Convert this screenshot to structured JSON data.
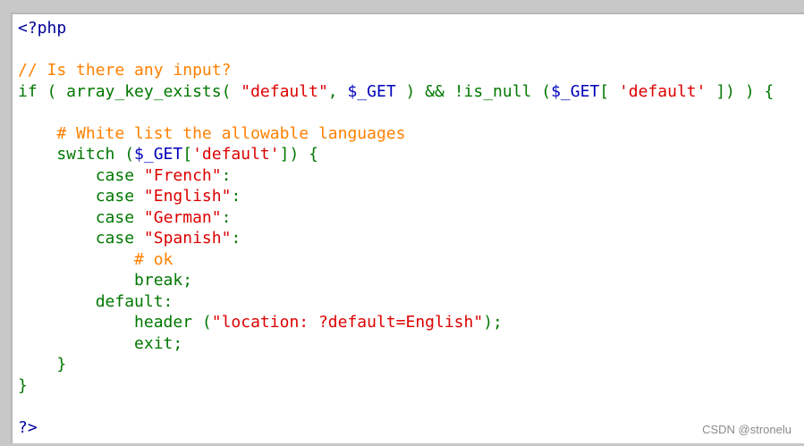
{
  "colors": {
    "code_background": "#ffffff",
    "page_background": "#c8c8c8",
    "php_tag": "#000099",
    "keyword": "#007700",
    "variable": "#0000BB",
    "string": "#DD0000",
    "comment": "#FF8000",
    "plain": "#007700",
    "watermark": "#8a8a8a"
  },
  "code": {
    "lines": [
      [
        {
          "t": "<?php",
          "c": "php_tag"
        }
      ],
      [],
      [
        {
          "t": "// Is there any input?",
          "c": "comment"
        }
      ],
      [
        {
          "t": "if ( array_key_exists( ",
          "c": "keyword"
        },
        {
          "t": "\"default\"",
          "c": "string"
        },
        {
          "t": ", ",
          "c": "keyword"
        },
        {
          "t": "$_GET",
          "c": "variable"
        },
        {
          "t": " ) && !is_null (",
          "c": "keyword"
        },
        {
          "t": "$_GET",
          "c": "variable"
        },
        {
          "t": "[ ",
          "c": "keyword"
        },
        {
          "t": "'default'",
          "c": "string"
        },
        {
          "t": " ]) ) {",
          "c": "keyword"
        }
      ],
      [],
      [
        {
          "t": "    # White list the allowable languages",
          "c": "comment"
        }
      ],
      [
        {
          "t": "    switch (",
          "c": "keyword"
        },
        {
          "t": "$_GET",
          "c": "variable"
        },
        {
          "t": "[",
          "c": "keyword"
        },
        {
          "t": "'default'",
          "c": "string"
        },
        {
          "t": "]) {",
          "c": "keyword"
        }
      ],
      [
        {
          "t": "        case ",
          "c": "keyword"
        },
        {
          "t": "\"French\"",
          "c": "string"
        },
        {
          "t": ":",
          "c": "keyword"
        }
      ],
      [
        {
          "t": "        case ",
          "c": "keyword"
        },
        {
          "t": "\"English\"",
          "c": "string"
        },
        {
          "t": ":",
          "c": "keyword"
        }
      ],
      [
        {
          "t": "        case ",
          "c": "keyword"
        },
        {
          "t": "\"German\"",
          "c": "string"
        },
        {
          "t": ":",
          "c": "keyword"
        }
      ],
      [
        {
          "t": "        case ",
          "c": "keyword"
        },
        {
          "t": "\"Spanish\"",
          "c": "string"
        },
        {
          "t": ":",
          "c": "keyword"
        }
      ],
      [
        {
          "t": "            # ok",
          "c": "comment"
        }
      ],
      [
        {
          "t": "            break;",
          "c": "keyword"
        }
      ],
      [
        {
          "t": "        default:",
          "c": "keyword"
        }
      ],
      [
        {
          "t": "            header (",
          "c": "keyword"
        },
        {
          "t": "\"location: ?default=English\"",
          "c": "string"
        },
        {
          "t": ");",
          "c": "keyword"
        }
      ],
      [
        {
          "t": "            exit;",
          "c": "keyword"
        }
      ],
      [
        {
          "t": "    }",
          "c": "keyword"
        }
      ],
      [
        {
          "t": "}",
          "c": "keyword"
        }
      ],
      [],
      [
        {
          "t": "?>",
          "c": "php_tag"
        }
      ]
    ]
  },
  "watermark": "CSDN @stronelu"
}
